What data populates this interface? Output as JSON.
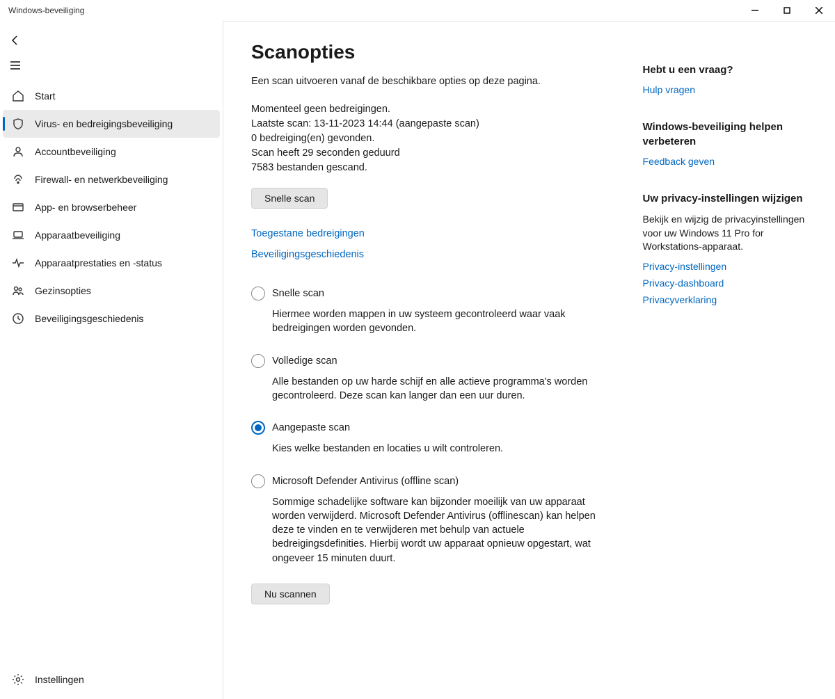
{
  "window": {
    "title": "Windows-beveiliging"
  },
  "sidebar": {
    "items": [
      {
        "label": "Start"
      },
      {
        "label": "Virus- en bedreigingsbeveiliging"
      },
      {
        "label": "Accountbeveiliging"
      },
      {
        "label": "Firewall- en netwerkbeveiliging"
      },
      {
        "label": "App- en browserbeheer"
      },
      {
        "label": "Apparaatbeveiliging"
      },
      {
        "label": "Apparaatprestaties en -status"
      },
      {
        "label": "Gezinsopties"
      },
      {
        "label": "Beveiligingsgeschiedenis"
      }
    ],
    "settings_label": "Instellingen"
  },
  "page": {
    "title": "Scanopties",
    "subtitle": "Een scan uitvoeren vanaf de beschikbare opties op deze pagina.",
    "status": {
      "line1": "Momenteel geen bedreigingen.",
      "line2": "Laatste scan: 13-11-2023 14:44 (aangepaste scan)",
      "line3": "0 bedreiging(en) gevonden.",
      "line4": "Scan heeft 29 seconden  geduurd",
      "line5": "7583 bestanden gescand."
    },
    "quick_scan_button": "Snelle scan",
    "links": {
      "allowed_threats": "Toegestane bedreigingen",
      "history": "Beveiligingsgeschiedenis"
    },
    "options": [
      {
        "label": "Snelle scan",
        "desc": "Hiermee worden mappen in uw systeem gecontroleerd waar vaak bedreigingen worden gevonden.",
        "selected": false
      },
      {
        "label": "Volledige scan",
        "desc": "Alle bestanden op uw harde schijf en alle actieve programma's worden gecontroleerd. Deze scan kan langer dan een uur duren.",
        "selected": false
      },
      {
        "label": "Aangepaste scan",
        "desc": "Kies welke bestanden en locaties u wilt controleren.",
        "selected": true
      },
      {
        "label": "Microsoft Defender Antivirus (offline scan)",
        "desc": "Sommige schadelijke software kan bijzonder moeilijk van uw apparaat worden verwijderd. Microsoft Defender Antivirus (offlinescan) kan helpen deze te vinden en te verwijderen met behulp van actuele bedreigingsdefinities. Hierbij wordt uw apparaat opnieuw opgestart, wat ongeveer 15 minuten duurt.",
        "selected": false
      }
    ],
    "scan_now_button": "Nu scannen"
  },
  "aside": {
    "question": {
      "heading": "Hebt u een vraag?",
      "link": "Hulp vragen"
    },
    "improve": {
      "heading": "Windows-beveiliging helpen verbeteren",
      "link": "Feedback geven"
    },
    "privacy": {
      "heading": "Uw privacy-instellingen wijzigen",
      "text": "Bekijk en wijzig de privacyinstellingen voor uw Windows 11 Pro for Workstations-apparaat.",
      "links": [
        "Privacy-instellingen",
        "Privacy-dashboard",
        "Privacyverklaring"
      ]
    }
  }
}
